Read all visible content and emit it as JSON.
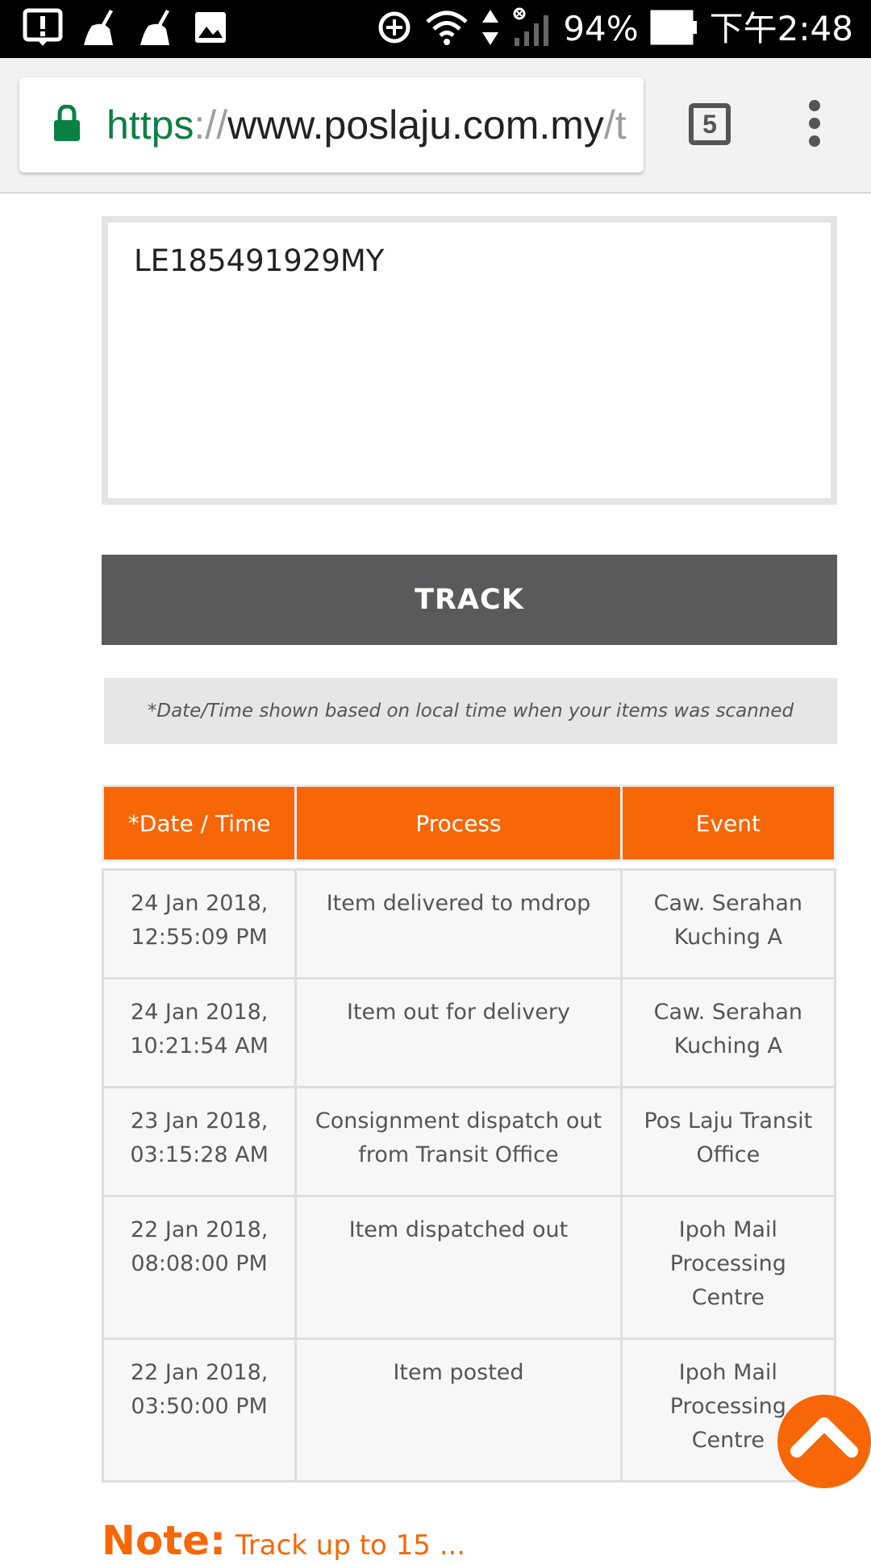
{
  "status_bar": {
    "battery": "94%",
    "time": "下午2:48"
  },
  "browser": {
    "url_scheme": "https",
    "url_sep": "://",
    "url_host": "www.poslaju.com.my",
    "url_path": "/t",
    "tab_count": "5"
  },
  "tracking": {
    "input_value": "LE185491929MY",
    "track_label": "TRACK",
    "note": "*Date/Time shown based on local time when your items was scanned"
  },
  "table": {
    "headers": [
      "*Date / Time",
      "Process",
      "Event"
    ],
    "rows": [
      {
        "date": "24 Jan 2018,",
        "time": "12:55:09 PM",
        "process": "Item delivered to mdrop",
        "event": "Caw. Serahan Kuching A"
      },
      {
        "date": "24 Jan 2018,",
        "time": "10:21:54 AM",
        "process": "Item out for delivery",
        "event": "Caw. Serahan Kuching A"
      },
      {
        "date": "23 Jan 2018,",
        "time": "03:15:28 AM",
        "process": "Consignment dispatch out from Transit Office",
        "event": "Pos Laju Transit Office"
      },
      {
        "date": "22 Jan 2018,",
        "time": "08:08:00 PM",
        "process": "Item dispatched out",
        "event": "Ipoh Mail Processing Centre"
      },
      {
        "date": "22 Jan 2018,",
        "time": "03:50:00 PM",
        "process": "Item posted",
        "event": "Ipoh Mail Processing Centre"
      }
    ]
  },
  "bottom_note": {
    "strong": "Note:",
    "rest": "Track up to 15 ..."
  },
  "colors": {
    "accent": "#f76707",
    "button": "#5a5a5c",
    "url_green": "#0b8043"
  }
}
